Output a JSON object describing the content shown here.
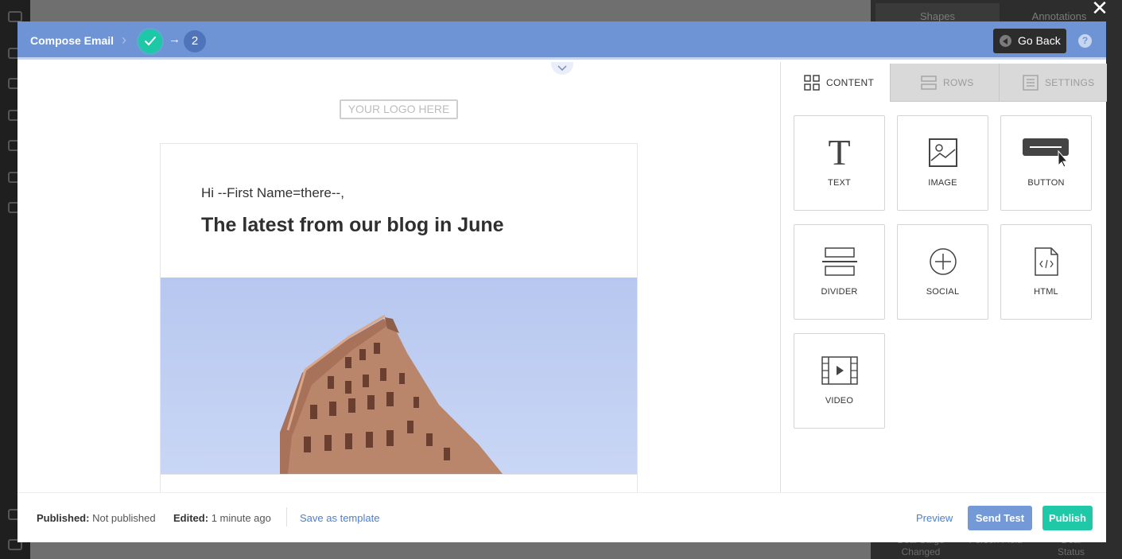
{
  "background": {
    "right_tabs": [
      "Shapes",
      "Annotations"
    ],
    "footer_labels": [
      "Deal Stage Changed",
      "Person Field",
      "Deal Status"
    ]
  },
  "header": {
    "title": "Compose Email",
    "step_current": "2"
  },
  "buttons": {
    "go_back": "Go Back",
    "help": "?",
    "close": "✕"
  },
  "email": {
    "logo_placeholder": "YOUR LOGO HERE",
    "greeting": "Hi --First Name=there--,",
    "heading": "The latest from our blog in June"
  },
  "panel": {
    "tabs": [
      {
        "label": "CONTENT",
        "active": true
      },
      {
        "label": "ROWS",
        "active": false
      },
      {
        "label": "SETTINGS",
        "active": false
      }
    ],
    "blocks": [
      {
        "label": "TEXT",
        "icon": "text-icon"
      },
      {
        "label": "IMAGE",
        "icon": "image-icon"
      },
      {
        "label": "BUTTON",
        "icon": "button-icon"
      },
      {
        "label": "DIVIDER",
        "icon": "divider-icon"
      },
      {
        "label": "SOCIAL",
        "icon": "social-icon"
      },
      {
        "label": "HTML",
        "icon": "html-icon"
      },
      {
        "label": "VIDEO",
        "icon": "video-icon"
      }
    ]
  },
  "footer": {
    "published_label": "Published:",
    "published_value": "Not published",
    "edited_label": "Edited:",
    "edited_value": "1 minute ago",
    "save_template": "Save as template",
    "preview": "Preview",
    "send_test": "Send Test",
    "publish": "Publish"
  },
  "colors": {
    "header": "#6f94d6",
    "accent_green": "#1fc8a6",
    "send_test": "#7399d7",
    "link": "#4a7fcf"
  }
}
